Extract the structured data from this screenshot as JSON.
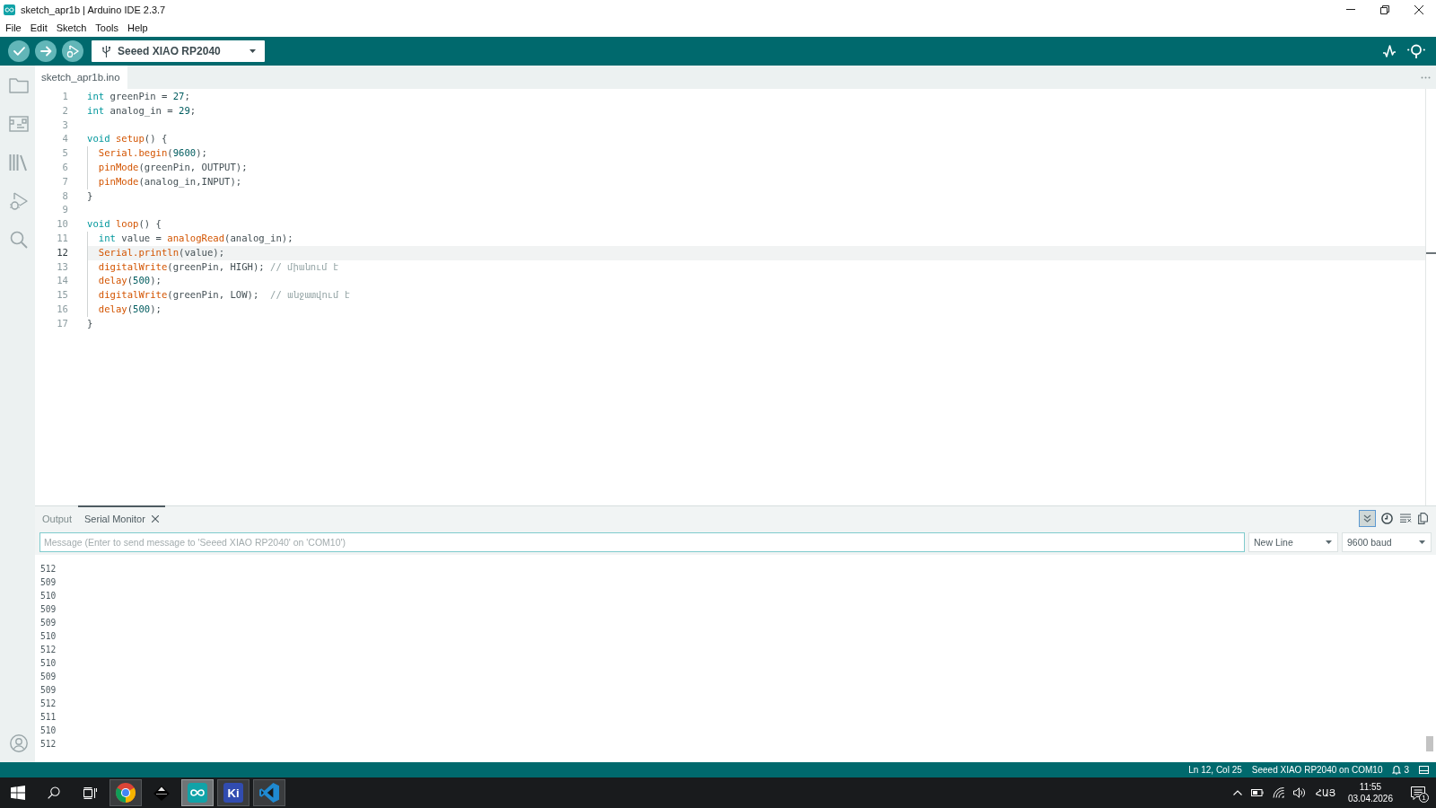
{
  "window": {
    "title": "sketch_apr1b | Arduino IDE 2.3.7"
  },
  "menu": [
    "File",
    "Edit",
    "Sketch",
    "Tools",
    "Help"
  ],
  "toolbar": {
    "board": "Seeed XIAO RP2040"
  },
  "sidebar": {
    "items": [
      {
        "kind": "sketchbook",
        "selected": false
      },
      {
        "kind": "boards",
        "selected": false
      },
      {
        "kind": "library",
        "selected": false
      },
      {
        "kind": "debug",
        "selected": false
      },
      {
        "kind": "search",
        "selected": false
      }
    ]
  },
  "editor": {
    "tabs": [
      {
        "label": "sketch_apr1b.ino",
        "selected": true
      }
    ],
    "lines": [
      {
        "number": "1",
        "current": false,
        "tokens": [
          {
            "kind": "keyword",
            "text": "int"
          },
          {
            "kind": "plain",
            "text": " greenPin = "
          },
          {
            "kind": "number",
            "text": "27"
          },
          {
            "kind": "plain",
            "text": ";"
          }
        ]
      },
      {
        "number": "2",
        "current": false,
        "tokens": [
          {
            "kind": "keyword",
            "text": "int"
          },
          {
            "kind": "plain",
            "text": " analog_in = "
          },
          {
            "kind": "number",
            "text": "29"
          },
          {
            "kind": "plain",
            "text": ";"
          }
        ]
      },
      {
        "number": "3",
        "current": false
      },
      {
        "number": "4",
        "current": false,
        "tokens": [
          {
            "kind": "keyword",
            "text": "void"
          },
          {
            "kind": "function",
            "text": " setup"
          },
          {
            "kind": "plain",
            "text": "() {"
          }
        ],
        "children": [
          {
            "number": "5",
            "current": false,
            "tokens": [
              {
                "kind": "function",
                "text": "Serial.begin"
              },
              {
                "kind": "plain",
                "text": "("
              },
              {
                "kind": "number",
                "text": "9600"
              },
              {
                "kind": "plain",
                "text": ");"
              }
            ]
          },
          {
            "number": "6",
            "current": false,
            "tokens": [
              {
                "kind": "function",
                "text": "pinMode"
              },
              {
                "kind": "plain",
                "text": "(greenPin, OUTPUT);"
              }
            ]
          },
          {
            "number": "7",
            "current": false,
            "tokens": [
              {
                "kind": "function",
                "text": "pinMode"
              },
              {
                "kind": "plain",
                "text": "(analog_in,INPUT);"
              }
            ]
          }
        ]
      },
      {
        "number": "8",
        "current": false,
        "tokens": [
          {
            "kind": "plain",
            "text": "}"
          }
        ]
      },
      {
        "number": "9",
        "current": false
      },
      {
        "number": "10",
        "current": false,
        "tokens": [
          {
            "kind": "keyword",
            "text": "void"
          },
          {
            "kind": "function",
            "text": " loop"
          },
          {
            "kind": "plain",
            "text": "() {"
          }
        ],
        "children": [
          {
            "number": "11",
            "current": false,
            "tokens": [
              {
                "kind": "keyword",
                "text": "int"
              },
              {
                "kind": "plain",
                "text": " value = "
              },
              {
                "kind": "function",
                "text": "analogRead"
              },
              {
                "kind": "plain",
                "text": "(analog_in);"
              }
            ]
          },
          {
            "number": "12",
            "current": true,
            "tokens": [
              {
                "kind": "function",
                "text": "Serial.println"
              },
              {
                "kind": "plain",
                "text": "(value);"
              }
            ]
          },
          {
            "number": "13",
            "current": false,
            "tokens": [
              {
                "kind": "function",
                "text": "digitalWrite"
              },
              {
                "kind": "plain",
                "text": "(greenPin, HIGH);"
              },
              {
                "kind": "comment",
                "text": " // միանում է"
              }
            ]
          },
          {
            "number": "14",
            "current": false,
            "tokens": [
              {
                "kind": "function",
                "text": "delay"
              },
              {
                "kind": "plain",
                "text": "("
              },
              {
                "kind": "number",
                "text": "500"
              },
              {
                "kind": "plain",
                "text": ");"
              }
            ]
          },
          {
            "number": "15",
            "current": false,
            "tokens": [
              {
                "kind": "function",
                "text": "digitalWrite"
              },
              {
                "kind": "plain",
                "text": "(greenPin, LOW);"
              },
              {
                "kind": "comment",
                "text": "  // անջատվում է"
              }
            ]
          },
          {
            "number": "16",
            "current": false,
            "tokens": [
              {
                "kind": "function",
                "text": "delay"
              },
              {
                "kind": "plain",
                "text": "("
              },
              {
                "kind": "number",
                "text": "500"
              },
              {
                "kind": "plain",
                "text": ");"
              }
            ]
          }
        ]
      },
      {
        "number": "17",
        "current": false,
        "tokens": [
          {
            "kind": "plain",
            "text": "}"
          }
        ]
      }
    ]
  },
  "panel": {
    "tabs": [
      {
        "label": "Output",
        "selected": false,
        "closable": false
      },
      {
        "label": "Serial Monitor",
        "selected": true,
        "closable": true
      }
    ],
    "toggles": [
      {
        "kind": "autoscroll",
        "on": true
      },
      {
        "kind": "timestamp",
        "on": false
      }
    ],
    "message": {
      "placeholder": "Message (Enter to send message to 'Seeed XIAO RP2040' on 'COM10')"
    },
    "line_ending": "New Line",
    "baud_rate": "9600 baud",
    "output": [
      "512",
      "509",
      "510",
      "509",
      "509",
      "510",
      "512",
      "510",
      "509",
      "509",
      "512",
      "511",
      "510",
      "512"
    ]
  },
  "status_bar": {
    "position": "Ln 12, Col 25",
    "board": "Seeed XIAO RP2040 on COM10",
    "notifications": "3"
  },
  "taskbar": {
    "apps": [
      {
        "kind": "browser",
        "running": true,
        "selected": false
      },
      {
        "kind": "diamond",
        "running": false,
        "selected": false
      },
      {
        "kind": "arduino",
        "running": true,
        "selected": true
      },
      {
        "kind": "tile",
        "label": "Ki",
        "running": true,
        "selected": false
      },
      {
        "kind": "ribbon",
        "running": true,
        "selected": false
      }
    ],
    "language": "ՀԱՅ",
    "time": "11:55",
    "date": "03.04.2026",
    "notification_count": "1"
  }
}
